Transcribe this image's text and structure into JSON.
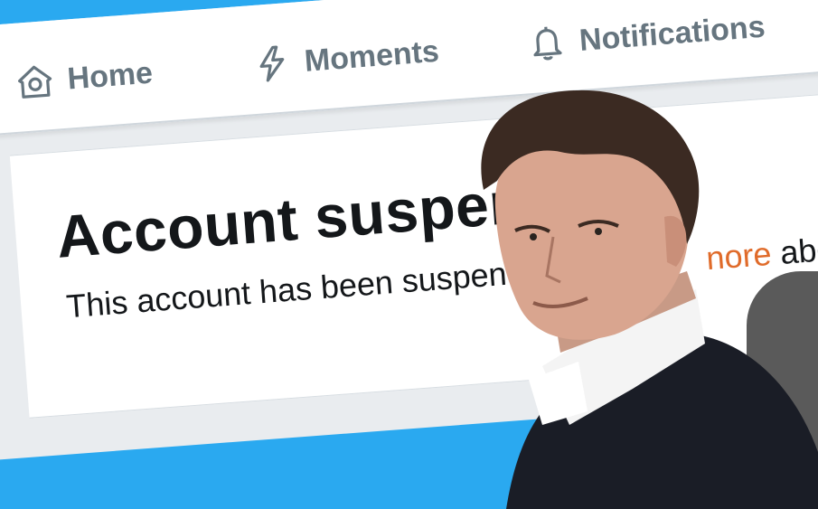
{
  "nav": {
    "home": {
      "label": "Home",
      "icon": "home-icon"
    },
    "moments": {
      "label": "Moments",
      "icon": "lightning-icon"
    },
    "notifications": {
      "label": "Notifications",
      "icon": "bell-icon"
    }
  },
  "notice": {
    "title": "Account suspen",
    "message": "This account has been suspen",
    "learn_link": "nore",
    "learn_tail": " abo"
  },
  "colors": {
    "background": "#2aa9f0",
    "nav_text": "#66757f",
    "link": "#e06b2a"
  }
}
